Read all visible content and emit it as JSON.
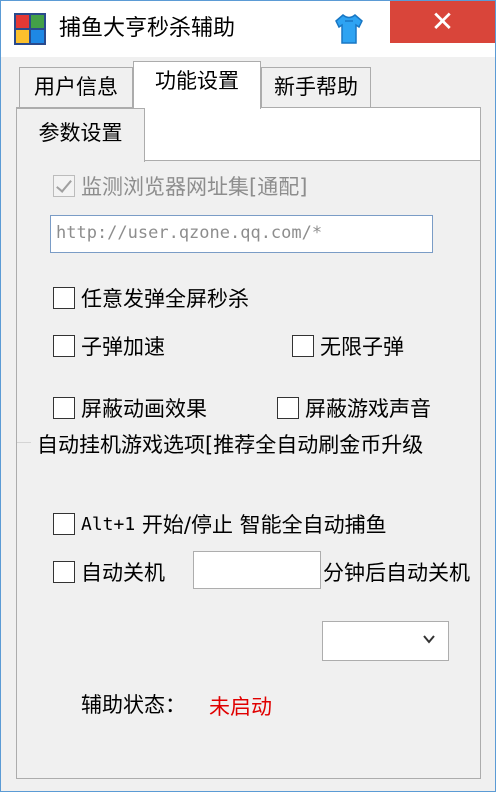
{
  "window": {
    "title": "捕鱼大亨秒杀辅助",
    "close_glyph": "✕"
  },
  "tabs": [
    {
      "label": "用户信息"
    },
    {
      "label": "功能设置"
    },
    {
      "label": "新手帮助"
    }
  ],
  "subtab": {
    "label": "参数设置"
  },
  "options": {
    "monitor_browser_label": "监测浏览器网址集[通配]",
    "url_value": "http://user.qzone.qq.com/*",
    "instant_kill_label": "任意发弹全屏秒杀",
    "bullet_speed_label": "子弹加速",
    "unlimited_bullets_label": "无限子弹",
    "block_animation_label": "屏蔽动画效果",
    "block_sound_label": "屏蔽游戏声音"
  },
  "auto_group": {
    "title": "自动挂机游戏选项[推荐全自动刷金币升级",
    "hotkey_text": "Alt+1",
    "hotkey_rest": " 开始/停止 智能全自动捕鱼",
    "auto_shutdown_label": "自动关机",
    "minutes_value": "",
    "minutes_suffix": "分钟后自动关机"
  },
  "status": {
    "label": "辅助状态：",
    "value": "未启动"
  },
  "colors": {
    "close": "#d9453a",
    "status_value": "#e00000"
  }
}
